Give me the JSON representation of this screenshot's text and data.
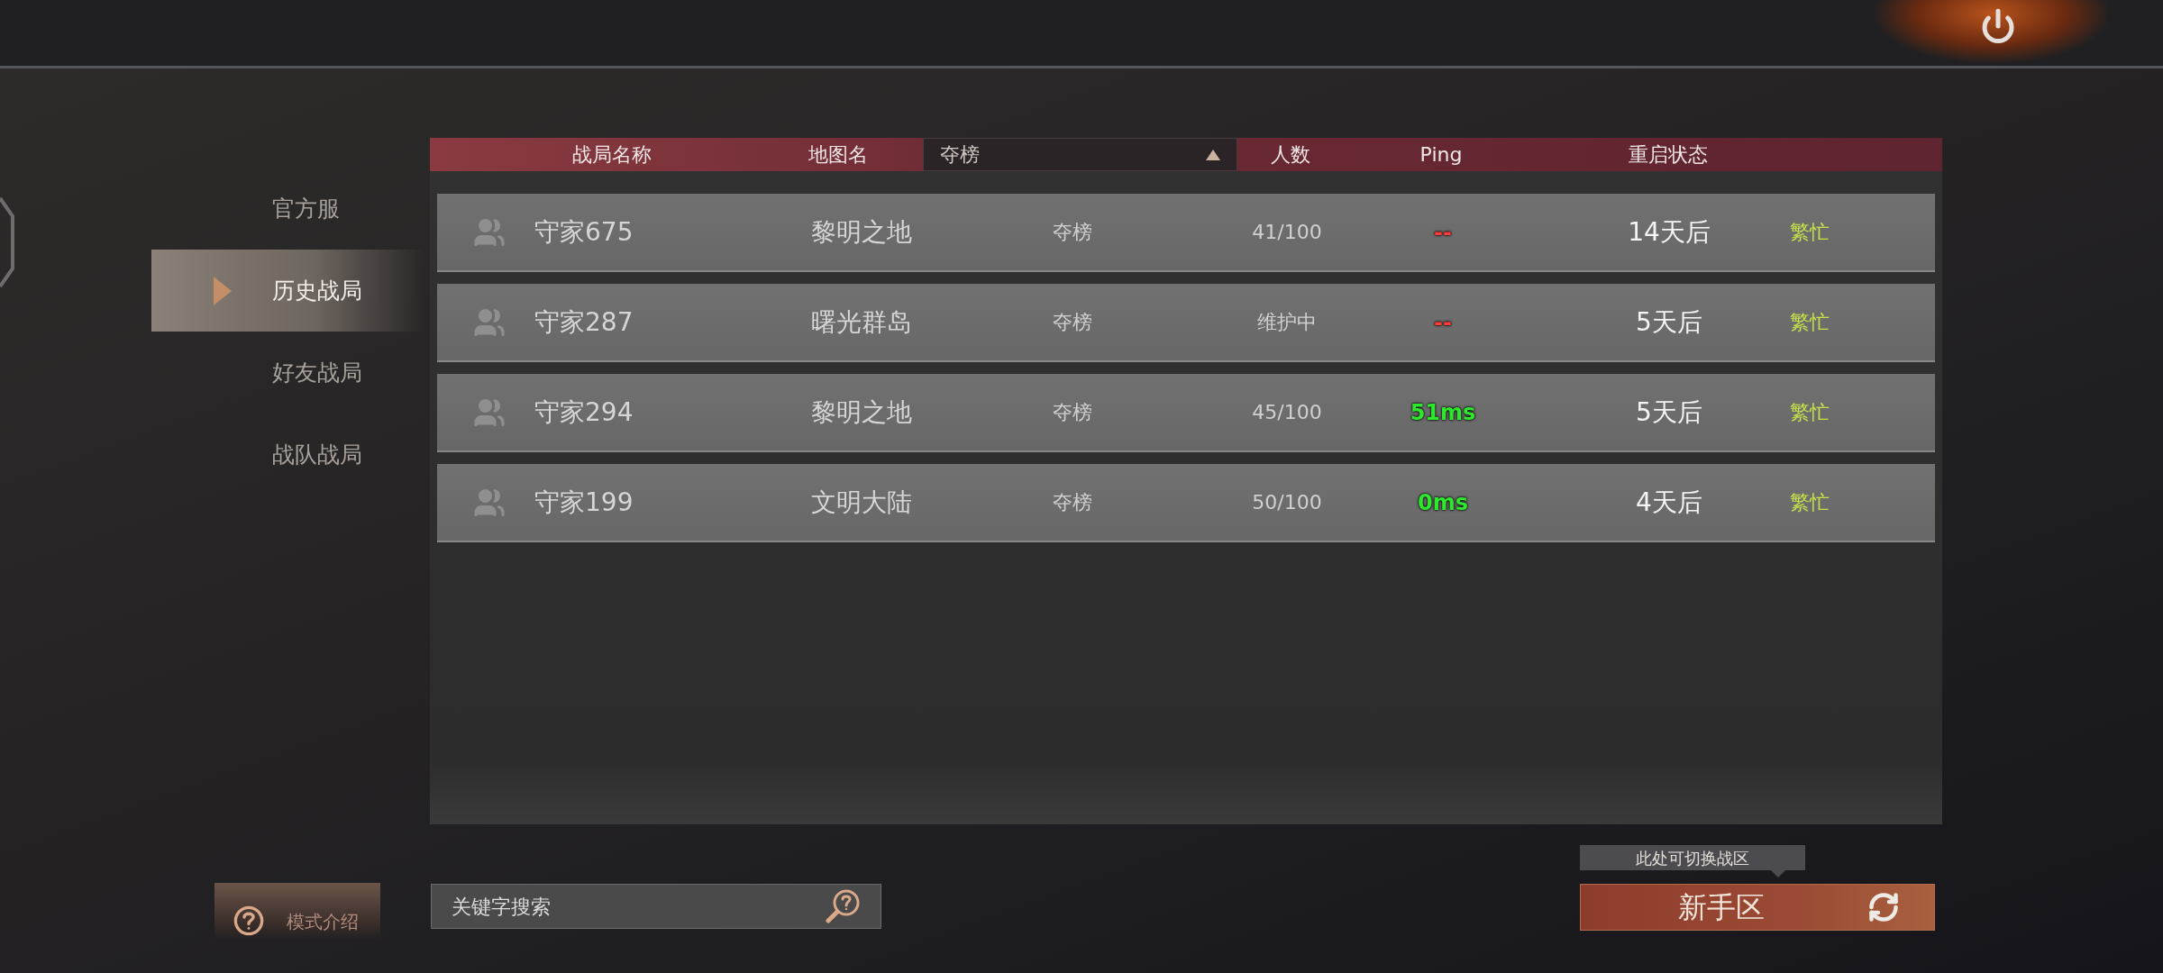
{
  "sidebar": {
    "items": [
      {
        "label": "官方服",
        "selected": false
      },
      {
        "label": "历史战局",
        "selected": true
      },
      {
        "label": "好友战局",
        "selected": false
      },
      {
        "label": "战队战局",
        "selected": false
      }
    ]
  },
  "table": {
    "columns": [
      "战局名称",
      "地图名"
    ],
    "mode_filter": {
      "value": "夺榜"
    },
    "columns_after": [
      "人数",
      "Ping",
      "重启状态"
    ],
    "rows": [
      {
        "name": "守家675",
        "map": "黎明之地",
        "mode": "夺榜",
        "players": "41/100",
        "ping": {
          "text": "--",
          "color": "#ff3a3a"
        },
        "restart": "14天后",
        "status": "繁忙"
      },
      {
        "name": "守家287",
        "map": "曙光群岛",
        "mode": "夺榜",
        "players": "维护中",
        "ping": {
          "text": "--",
          "color": "#ff3a3a"
        },
        "restart": "5天后",
        "status": "繁忙"
      },
      {
        "name": "守家294",
        "map": "黎明之地",
        "mode": "夺榜",
        "players": "45/100",
        "ping": {
          "text": "51ms",
          "color": "#2ee82e"
        },
        "restart": "5天后",
        "status": "繁忙"
      },
      {
        "name": "守家199",
        "map": "文明大陆",
        "mode": "夺榜",
        "players": "50/100",
        "ping": {
          "text": "0ms",
          "color": "#2ee82e"
        },
        "restart": "4天后",
        "status": "繁忙"
      }
    ]
  },
  "mode_intro_button": {
    "label": "模式介绍"
  },
  "search": {
    "placeholder": "关键字搜索"
  },
  "zone": {
    "tooltip": "此处可切换战区",
    "label": "新手区"
  }
}
